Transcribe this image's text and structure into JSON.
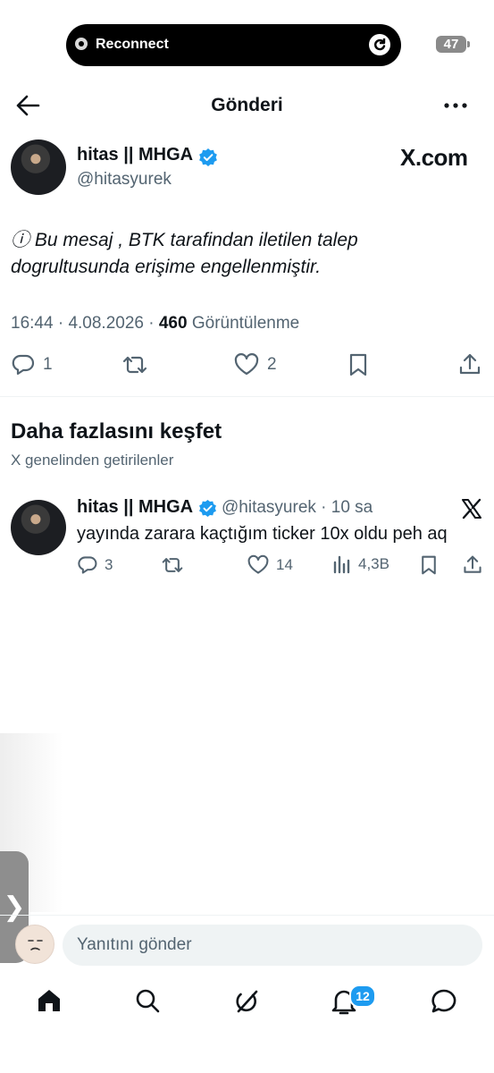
{
  "status": {
    "pill_label": "Reconnect",
    "battery": "47"
  },
  "header": {
    "title": "Gönderi"
  },
  "post": {
    "author_name": "hitas || MHGA",
    "author_handle": "@hitasyurek",
    "brand": "X.com",
    "text": "ⓘ Bu mesaj , BTK tarafindan iletilen talep dogrultusunda erişime engellenmiştir.",
    "time": "16:44",
    "date": "4.08.2026",
    "views": "460",
    "views_label": "Görüntülenme",
    "replies": "1",
    "likes": "2"
  },
  "discover": {
    "title": "Daha fazlasını keşfet",
    "subtitle": "X genelinden getirilenler",
    "tweet": {
      "author_name": "hitas || MHGA",
      "handle_time": "@hitasyurek · 10 sa",
      "text": "yayında zarara kaçtığım ticker 10x oldu peh aq",
      "replies": "3",
      "likes": "14",
      "views": "4,3B"
    }
  },
  "side_tab": {
    "glyph": "❯"
  },
  "reply": {
    "placeholder": "Yanıtını gönder"
  },
  "nav": {
    "notifications_badge": "12"
  },
  "colors": {
    "accent": "#1d9bf0",
    "text": "#0f1419",
    "secondary": "#536471"
  },
  "icons": [
    "back-arrow-icon",
    "more-icon",
    "verified-icon",
    "reply-icon",
    "repost-icon",
    "like-icon",
    "bookmark-icon",
    "share-icon",
    "x-logo-icon",
    "views-icon",
    "home-icon",
    "search-icon",
    "grok-icon",
    "bell-icon",
    "message-icon"
  ]
}
